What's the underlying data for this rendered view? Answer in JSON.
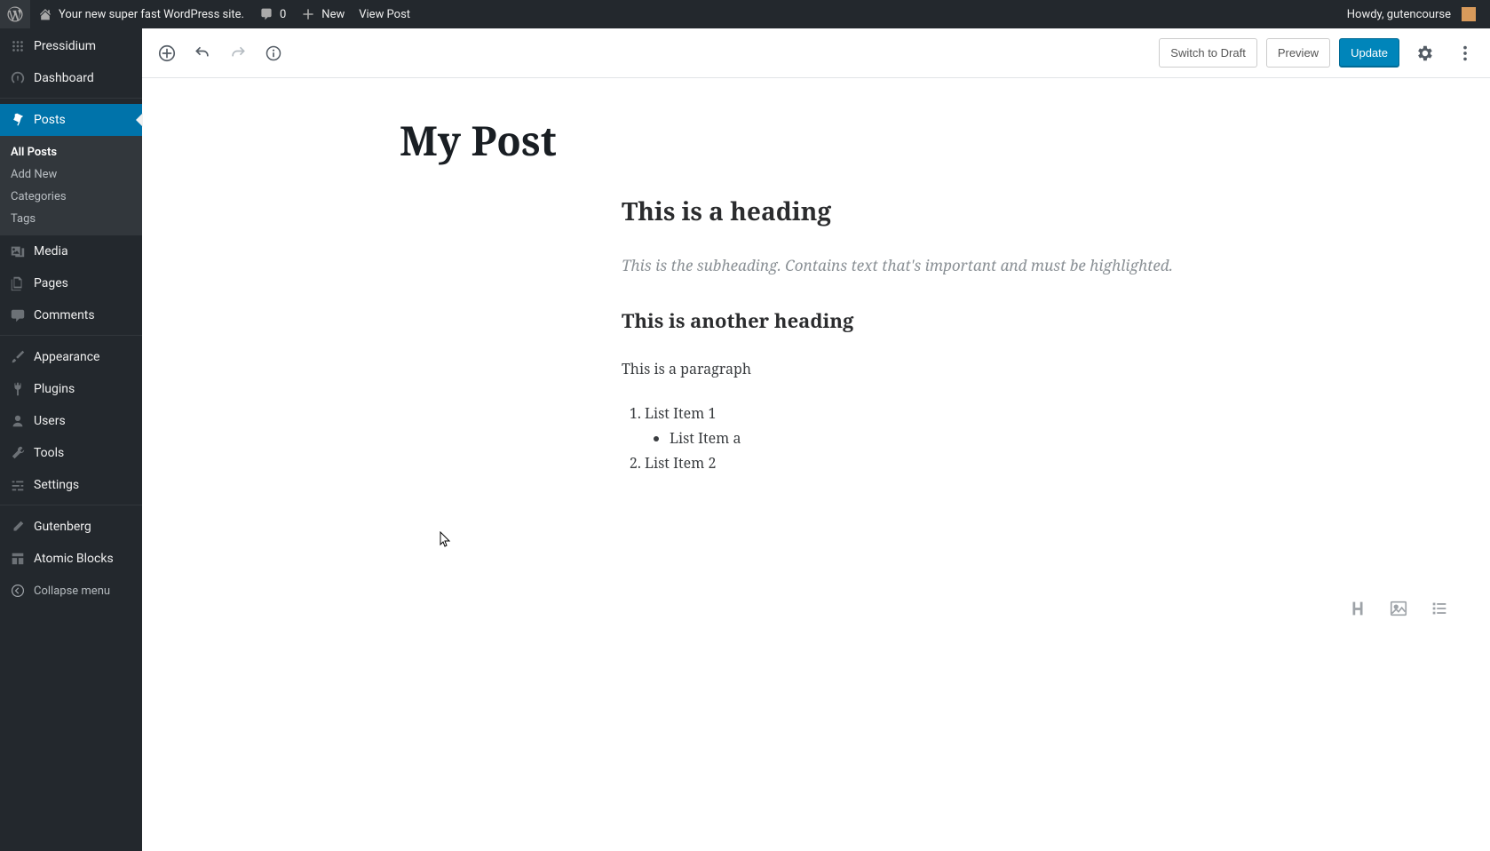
{
  "adminbar": {
    "site_title": "Your new super fast WordPress site.",
    "comments_count": "0",
    "new_label": "New",
    "view_post": "View Post",
    "howdy": "Howdy, gutencourse"
  },
  "sidebar": {
    "host": "Pressidium",
    "items": {
      "dashboard": "Dashboard",
      "posts": "Posts",
      "media": "Media",
      "pages": "Pages",
      "comments": "Comments",
      "appearance": "Appearance",
      "plugins": "Plugins",
      "users": "Users",
      "tools": "Tools",
      "settings": "Settings",
      "gutenberg": "Gutenberg",
      "atomic_blocks": "Atomic Blocks"
    },
    "posts_sub": {
      "all": "All Posts",
      "add_new": "Add New",
      "categories": "Categories",
      "tags": "Tags"
    },
    "collapse": "Collapse menu"
  },
  "toolbar": {
    "switch_draft": "Switch to Draft",
    "preview": "Preview",
    "update": "Update"
  },
  "post": {
    "title": "My Post",
    "heading1": "This is a heading",
    "subheading": "This is the subheading. Contains text that's important and must be highlighted.",
    "heading2": "This is another heading",
    "paragraph": "This is a paragraph",
    "list": {
      "item1": "List Item 1",
      "item1a": "List Item a",
      "item2": "List Item 2"
    }
  }
}
